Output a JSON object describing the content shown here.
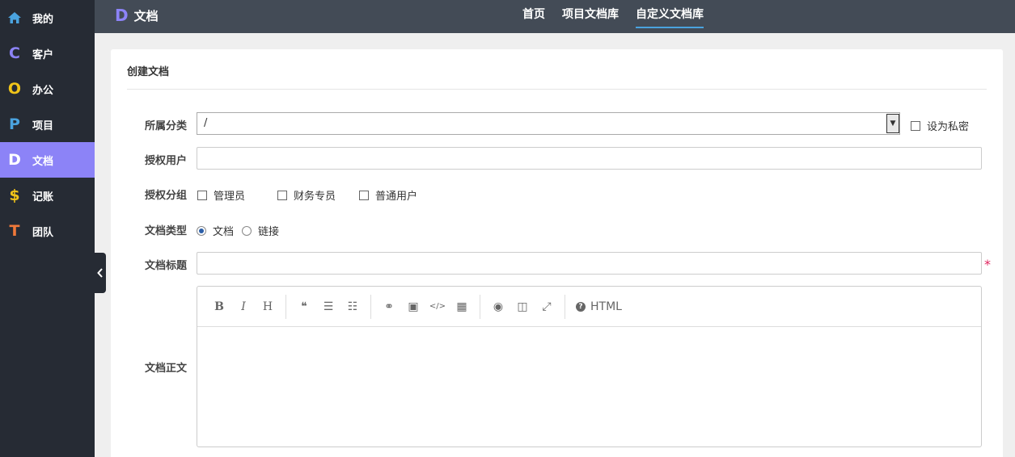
{
  "sidebar": {
    "items": [
      {
        "label": "我的",
        "icon": "home-icon",
        "glyph": "⌂",
        "color": "#4aa3df",
        "active": false
      },
      {
        "label": "客户",
        "icon": "letter-c-icon",
        "glyph": "C",
        "color": "#8c83f7",
        "active": false
      },
      {
        "label": "办公",
        "icon": "letter-o-icon",
        "glyph": "O",
        "color": "#f0c419",
        "active": false
      },
      {
        "label": "项目",
        "icon": "letter-p-icon",
        "glyph": "P",
        "color": "#4aa3df",
        "active": false
      },
      {
        "label": "文档",
        "icon": "letter-d-icon",
        "glyph": "D",
        "color": "#ffffff",
        "active": true
      },
      {
        "label": "记账",
        "icon": "dollar-icon",
        "glyph": "$",
        "color": "#f0c419",
        "active": false
      },
      {
        "label": "团队",
        "icon": "letter-t-icon",
        "glyph": "T",
        "color": "#f0793a",
        "active": false
      }
    ]
  },
  "header": {
    "logo_glyph": "D",
    "title": "文档",
    "nav": [
      {
        "label": "首页",
        "active": false
      },
      {
        "label": "项目文档库",
        "active": false
      },
      {
        "label": "自定义文档库",
        "active": true
      }
    ]
  },
  "form": {
    "card_title": "创建文档",
    "category": {
      "label": "所属分类",
      "value": "/",
      "arrow": "▼"
    },
    "private": {
      "label": "设为私密",
      "checked": false
    },
    "auth_users": {
      "label": "授权用户",
      "value": ""
    },
    "auth_groups": {
      "label": "授权分组",
      "options": [
        {
          "label": "管理员",
          "checked": false
        },
        {
          "label": "财务专员",
          "checked": false
        },
        {
          "label": "普通用户",
          "checked": false
        }
      ]
    },
    "doc_type": {
      "label": "文档类型",
      "options": [
        {
          "label": "文档",
          "checked": true
        },
        {
          "label": "链接",
          "checked": false
        }
      ]
    },
    "doc_title": {
      "label": "文档标题",
      "value": "",
      "required_mark": "*"
    },
    "doc_body": {
      "label": "文档正文",
      "value": ""
    }
  },
  "editor_toolbar": {
    "bold": "B",
    "italic": "I",
    "heading": "H",
    "quote": "❝",
    "ul": "☰",
    "ol": "☷",
    "link": "⚭",
    "image": "▣",
    "code": "</>",
    "table": "▦",
    "preview": "◉",
    "side_by_side": "◫",
    "fullscreen": "⤢",
    "help": "?",
    "html": "HTML"
  },
  "colors": {
    "sidebar_bg": "#262b34",
    "active_bg": "#8c83f7",
    "topbar_bg": "#434b56",
    "accent": "#4aa3df"
  }
}
